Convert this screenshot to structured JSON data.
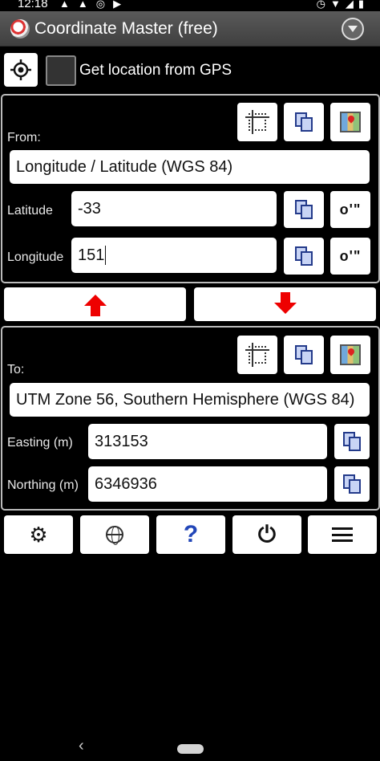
{
  "status": {
    "time": "12:18"
  },
  "app": {
    "title": "Coordinate Master (free)"
  },
  "gps": {
    "label": "Get location from GPS",
    "checked": false
  },
  "from": {
    "label": "From:",
    "system": "Longitude / Latitude (WGS 84)",
    "fields": [
      {
        "label": "Latitude",
        "value": "-33",
        "format_label": "o'\""
      },
      {
        "label": "Longitude",
        "value": "151",
        "format_label": "o'\""
      }
    ]
  },
  "to": {
    "label": "To:",
    "system": "UTM Zone 56, Southern Hemisphere (WGS 84)",
    "fields": [
      {
        "label": "Easting (m)",
        "value": "313153"
      },
      {
        "label": "Northing (m)",
        "value": "6346936"
      }
    ]
  },
  "toolbar": {
    "help_glyph": "?"
  },
  "colors": {
    "accent_arrow": "#e00000",
    "help": "#2246b8"
  }
}
